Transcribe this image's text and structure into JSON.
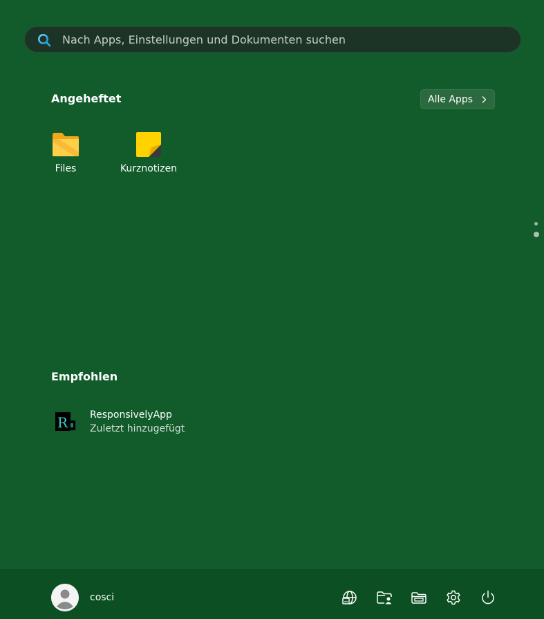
{
  "search": {
    "placeholder": "Nach Apps, Einstellungen und Dokumenten suchen",
    "icon": "search-icon"
  },
  "pinned": {
    "title": "Angeheftet",
    "all_apps_label": "Alle Apps",
    "apps": [
      {
        "label": "Files",
        "icon": "folder-icon"
      },
      {
        "label": "Kurznotizen",
        "icon": "sticky-notes-icon"
      }
    ]
  },
  "recommended": {
    "title": "Empfohlen",
    "items": [
      {
        "name": "ResponsivelyApp",
        "subtitle": "Zuletzt hinzugefügt",
        "icon": "responsively-app-icon"
      }
    ]
  },
  "footer": {
    "user_name": "cosci",
    "buttons": [
      {
        "icon": "web-icon"
      },
      {
        "icon": "folder-user-icon"
      },
      {
        "icon": "file-explorer-icon"
      },
      {
        "icon": "gear-icon"
      },
      {
        "icon": "power-icon"
      }
    ]
  },
  "colors": {
    "background": "#115c2a",
    "footer": "#0c4f22",
    "search_bg": "#1c3426",
    "button_bg": "#2a6a3e"
  }
}
